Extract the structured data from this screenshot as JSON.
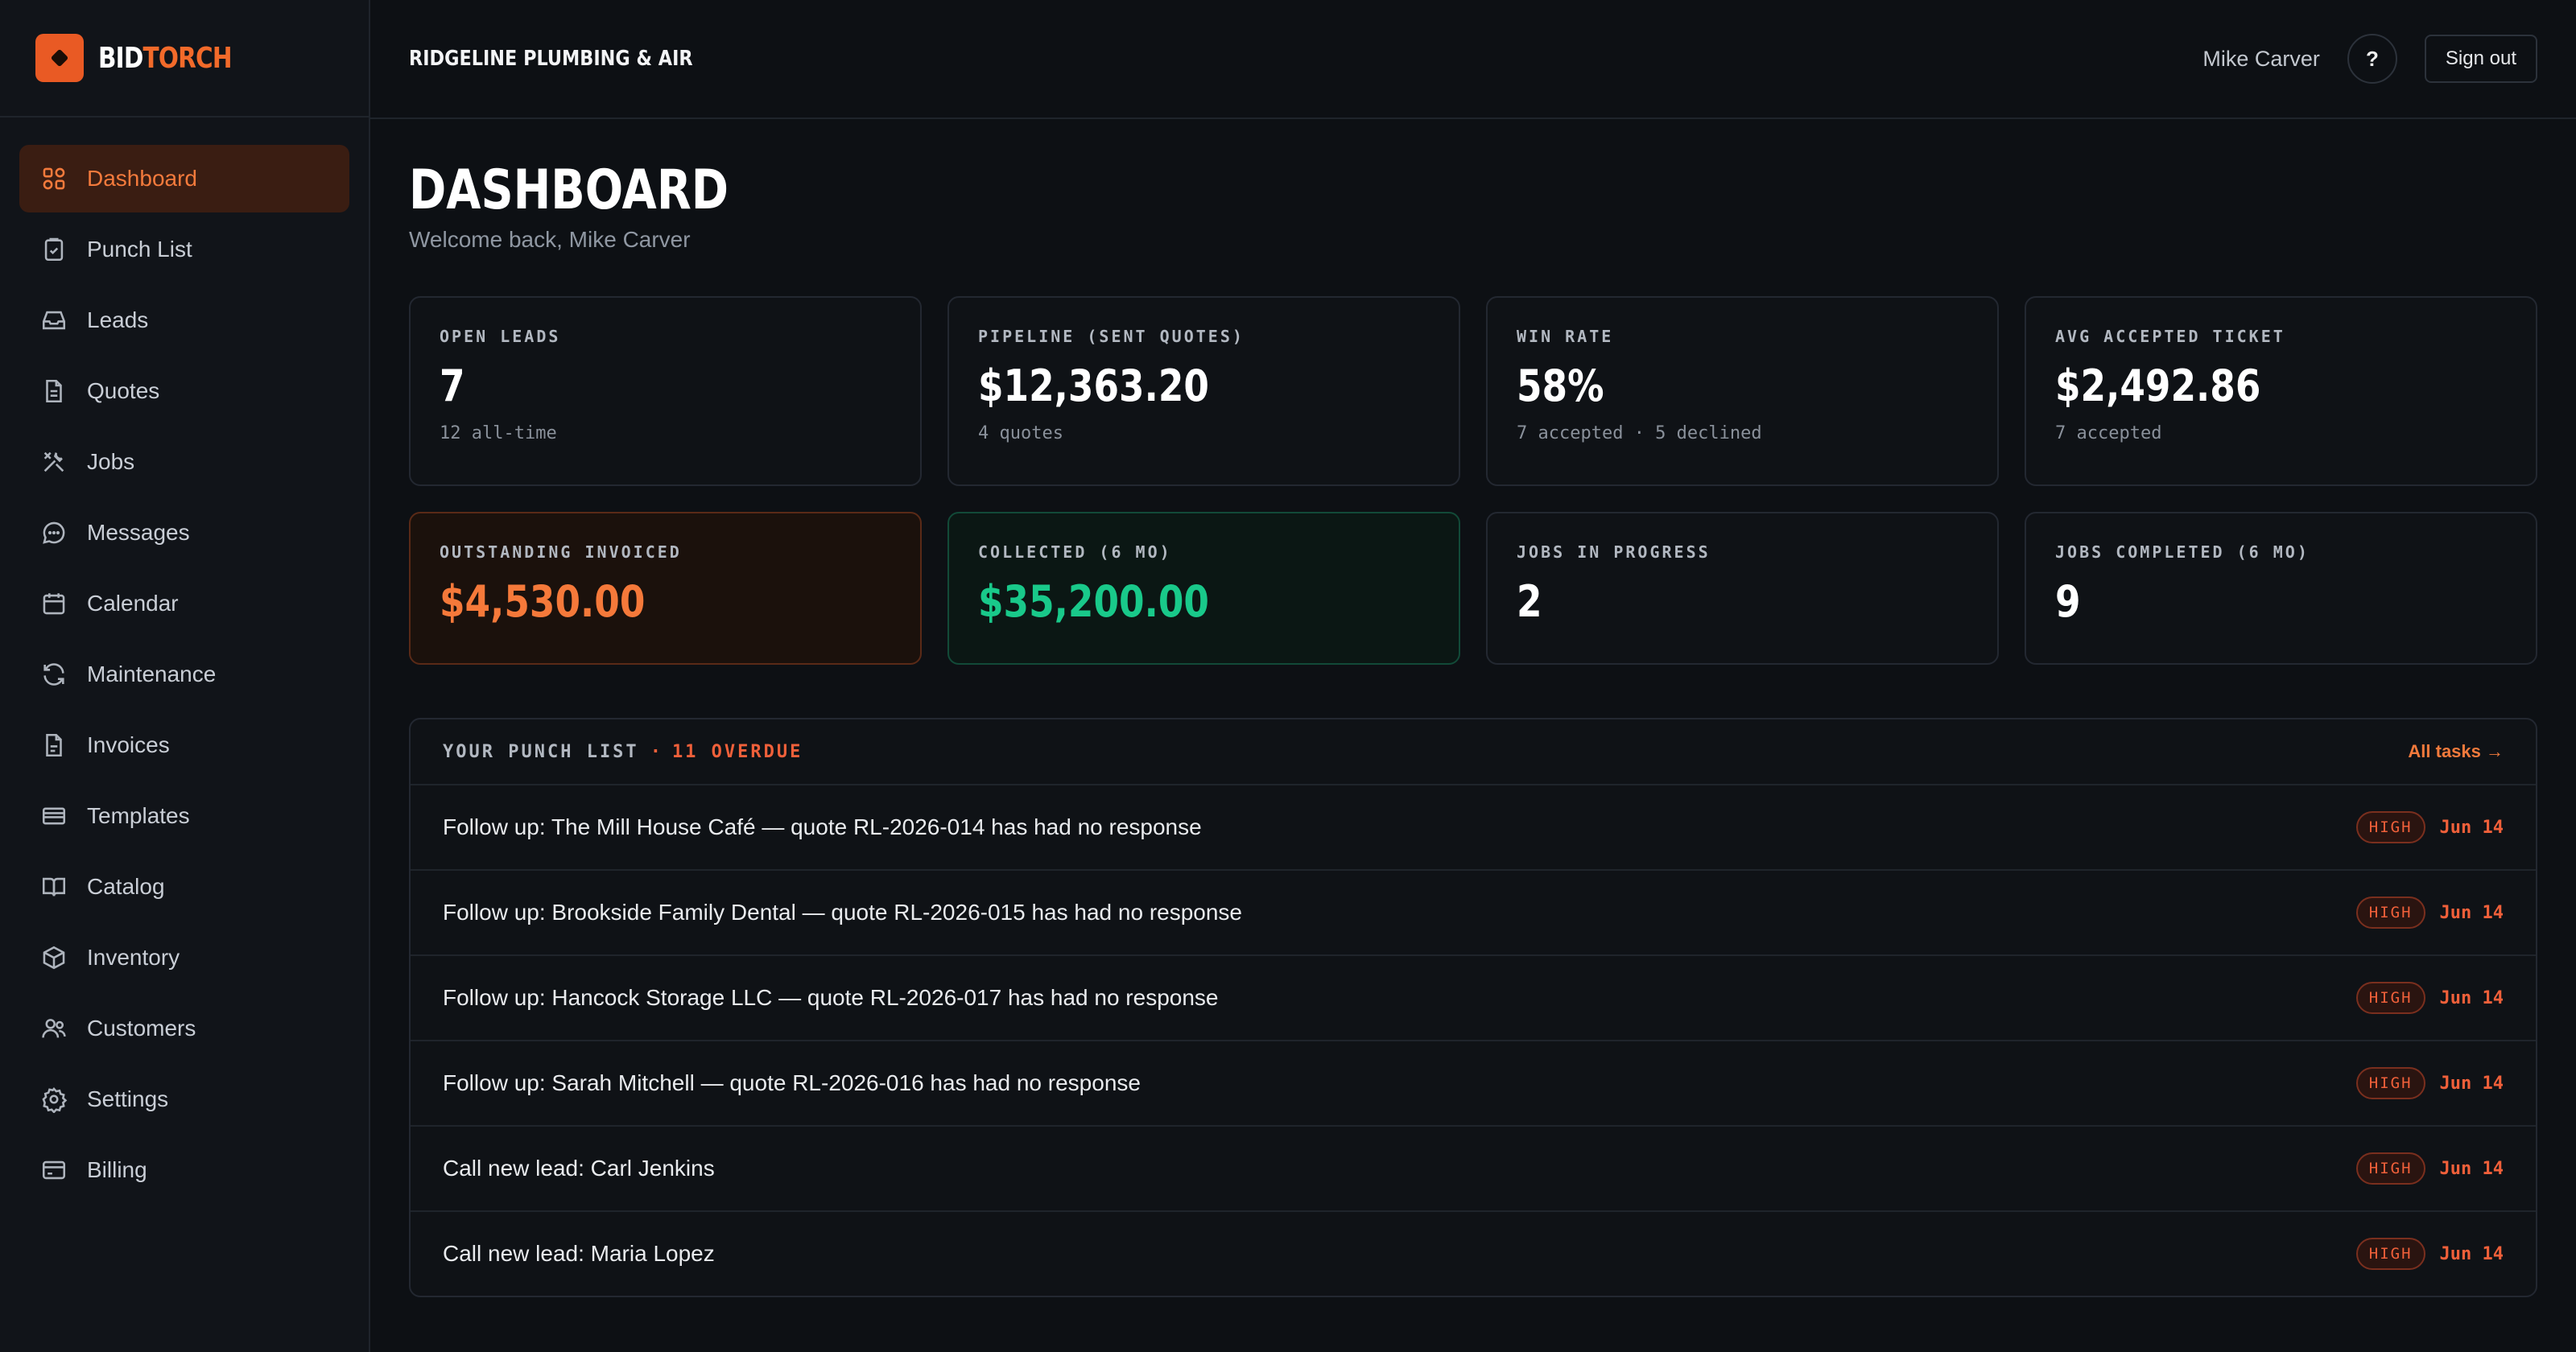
{
  "brand": {
    "name_part1": "BID",
    "name_part2": "TORCH"
  },
  "company": "RIDGELINE PLUMBING & AIR",
  "header": {
    "user_name": "Mike Carver",
    "help_label": "?",
    "signout_label": "Sign out"
  },
  "sidebar": {
    "items": [
      {
        "label": "Dashboard",
        "icon": "grid-icon",
        "active": true
      },
      {
        "label": "Punch List",
        "icon": "clipboard-check-icon"
      },
      {
        "label": "Leads",
        "icon": "inbox-icon"
      },
      {
        "label": "Quotes",
        "icon": "document-icon"
      },
      {
        "label": "Jobs",
        "icon": "tools-icon"
      },
      {
        "label": "Messages",
        "icon": "chat-icon"
      },
      {
        "label": "Calendar",
        "icon": "calendar-icon"
      },
      {
        "label": "Maintenance",
        "icon": "refresh-icon"
      },
      {
        "label": "Invoices",
        "icon": "file-icon"
      },
      {
        "label": "Templates",
        "icon": "template-icon"
      },
      {
        "label": "Catalog",
        "icon": "book-icon"
      },
      {
        "label": "Inventory",
        "icon": "box-icon"
      },
      {
        "label": "Customers",
        "icon": "users-icon"
      },
      {
        "label": "Settings",
        "icon": "gear-icon"
      },
      {
        "label": "Billing",
        "icon": "credit-card-icon"
      }
    ]
  },
  "page": {
    "title": "DASHBOARD",
    "welcome": "Welcome back, Mike Carver"
  },
  "stats": [
    {
      "label": "OPEN LEADS",
      "value": "7",
      "sub": "12 all-time"
    },
    {
      "label": "PIPELINE (SENT QUOTES)",
      "value": "$12,363.20",
      "sub": "4 quotes"
    },
    {
      "label": "WIN RATE",
      "value": "58%",
      "sub": "7 accepted · 5 declined"
    },
    {
      "label": "AVG ACCEPTED TICKET",
      "value": "$2,492.86",
      "sub": "7 accepted"
    },
    {
      "label": "OUTSTANDING INVOICED",
      "value": "$4,530.00",
      "sub": ""
    },
    {
      "label": "COLLECTED (6 MO)",
      "value": "$35,200.00",
      "sub": ""
    },
    {
      "label": "JOBS IN PROGRESS",
      "value": "2",
      "sub": ""
    },
    {
      "label": "JOBS COMPLETED (6 MO)",
      "value": "9",
      "sub": ""
    }
  ],
  "colors": {
    "accent": "#f37a3c",
    "danger": "#f0603a",
    "success": "#19c98a"
  },
  "punch": {
    "title": "YOUR PUNCH LIST",
    "separator": "·",
    "overdue": "11 OVERDUE",
    "all_tasks": "All tasks →",
    "tasks": [
      {
        "text": "Follow up: The Mill House Café — quote RL-2026-014 has had no response",
        "priority": "HIGH",
        "due": "Jun 14"
      },
      {
        "text": "Follow up: Brookside Family Dental — quote RL-2026-015 has had no response",
        "priority": "HIGH",
        "due": "Jun 14"
      },
      {
        "text": "Follow up: Hancock Storage LLC — quote RL-2026-017 has had no response",
        "priority": "HIGH",
        "due": "Jun 14"
      },
      {
        "text": "Follow up: Sarah Mitchell — quote RL-2026-016 has had no response",
        "priority": "HIGH",
        "due": "Jun 14"
      },
      {
        "text": "Call new lead: Carl Jenkins",
        "priority": "HIGH",
        "due": "Jun 14"
      },
      {
        "text": "Call new lead: Maria Lopez",
        "priority": "HIGH",
        "due": "Jun 14"
      }
    ]
  }
}
